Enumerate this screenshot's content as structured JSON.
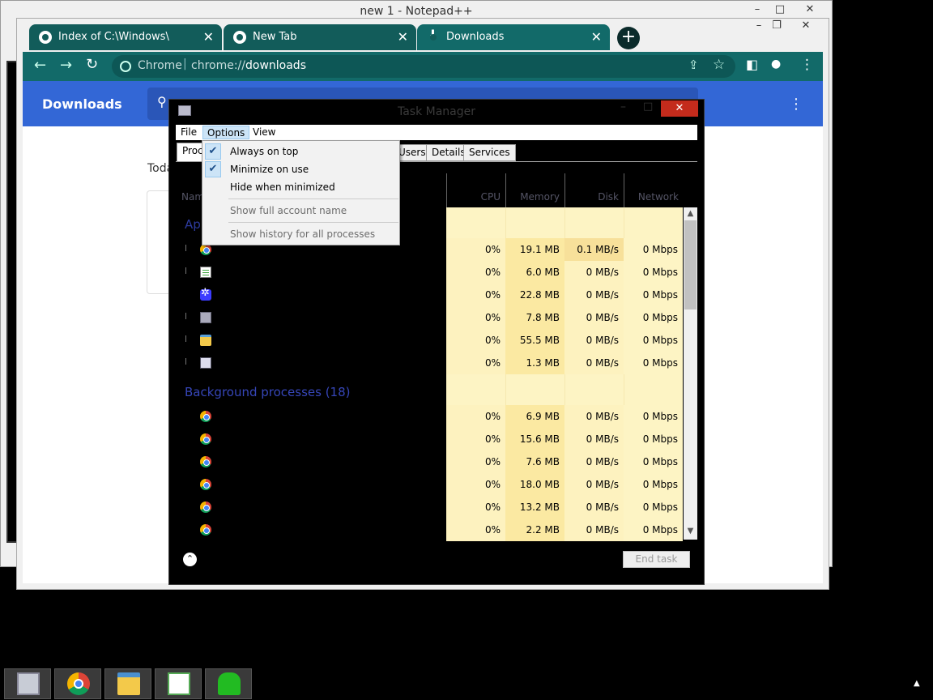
{
  "notepadpp": {
    "title": "new 1 - Notepad++",
    "min": "–",
    "max": "□",
    "close": "✕"
  },
  "chrome": {
    "tabs": [
      {
        "label": "Index of C:\\Windows\\",
        "close": "✕"
      },
      {
        "label": "New Tab",
        "close": "✕"
      },
      {
        "label": "Downloads",
        "close": "✕"
      }
    ],
    "new_tab": "+",
    "win_controls": {
      "min": "–",
      "max": "❐",
      "close": "✕"
    },
    "nav": {
      "back": "←",
      "forward": "→",
      "reload": "↻"
    },
    "omnibox": {
      "brand": "Chrome",
      "separator": "|",
      "url_prefix": "chrome://",
      "url_host": "downloads"
    },
    "toolbar_icons": {
      "share": "⇪",
      "star": "☆",
      "sidepanel": "◧",
      "profile": "●",
      "menu": "⋮"
    },
    "page": {
      "title": "Downloads",
      "search_icon": "⚲",
      "menu": "⋮",
      "today_label": "Toda"
    },
    "accent": "#126a69",
    "header_color": "#3367d6"
  },
  "task_manager": {
    "title": "Task Manager",
    "controls": {
      "min": "–",
      "max": "□",
      "close": "✕"
    },
    "menubar": [
      "File",
      "Options",
      "View"
    ],
    "tabs": [
      "Proc",
      "Users",
      "Details",
      "Services"
    ],
    "columns": {
      "name": "Nam",
      "cpu": "CPU",
      "memory": "Memory",
      "disk": "Disk",
      "network": "Network"
    },
    "groups": {
      "apps": "App",
      "background": "Background processes (18)"
    },
    "options_menu": [
      {
        "label": "Always on top",
        "checked": true,
        "enabled": true
      },
      {
        "label": "Minimize on use",
        "checked": true,
        "enabled": true
      },
      {
        "label": "Hide when minimized",
        "checked": false,
        "enabled": true
      },
      {
        "label": "Show full account name",
        "checked": false,
        "enabled": false
      },
      {
        "label": "Show history for all processes",
        "checked": false,
        "enabled": false
      }
    ],
    "check_glyph": "✔",
    "apps_rows": [
      {
        "icon": "chrome-icon",
        "cpu": "0%",
        "memory": "19.1 MB",
        "disk": "0.1 MB/s",
        "network": "0 Mbps"
      },
      {
        "icon": "notepad-icon",
        "cpu": "0%",
        "memory": "6.0 MB",
        "disk": "0 MB/s",
        "network": "0 Mbps"
      },
      {
        "icon": "settings-icon",
        "cpu": "0%",
        "memory": "22.8 MB",
        "disk": "0 MB/s",
        "network": "0 Mbps"
      },
      {
        "icon": "task-manager-icon",
        "cpu": "0%",
        "memory": "7.8 MB",
        "disk": "0 MB/s",
        "network": "0 Mbps"
      },
      {
        "icon": "file-explorer-icon",
        "cpu": "0%",
        "memory": "55.5 MB",
        "disk": "0 MB/s",
        "network": "0 Mbps"
      },
      {
        "icon": "window-icon",
        "cpu": "0%",
        "memory": "1.3 MB",
        "disk": "0 MB/s",
        "network": "0 Mbps"
      }
    ],
    "bg_rows": [
      {
        "icon": "chrome-icon",
        "cpu": "0%",
        "memory": "6.9 MB",
        "disk": "0 MB/s",
        "network": "0 Mbps"
      },
      {
        "icon": "chrome-icon",
        "cpu": "0%",
        "memory": "15.6 MB",
        "disk": "0 MB/s",
        "network": "0 Mbps"
      },
      {
        "icon": "chrome-icon",
        "cpu": "0%",
        "memory": "7.6 MB",
        "disk": "0 MB/s",
        "network": "0 Mbps"
      },
      {
        "icon": "chrome-icon",
        "cpu": "0%",
        "memory": "18.0 MB",
        "disk": "0 MB/s",
        "network": "0 Mbps"
      },
      {
        "icon": "chrome-icon",
        "cpu": "0%",
        "memory": "13.2 MB",
        "disk": "0 MB/s",
        "network": "0 Mbps"
      },
      {
        "icon": "chrome-icon",
        "cpu": "0%",
        "memory": "2.2 MB",
        "disk": "0 MB/s",
        "network": "0 Mbps"
      }
    ],
    "scroll_up": "▲",
    "scroll_down": "▼",
    "fewer_details": "⌃",
    "end_task": "End task"
  },
  "taskbar": {
    "items": [
      "task-manager",
      "chrome",
      "file-explorer",
      "notepad-plus-plus",
      "cygwin"
    ],
    "tray_arrow": "▲"
  }
}
